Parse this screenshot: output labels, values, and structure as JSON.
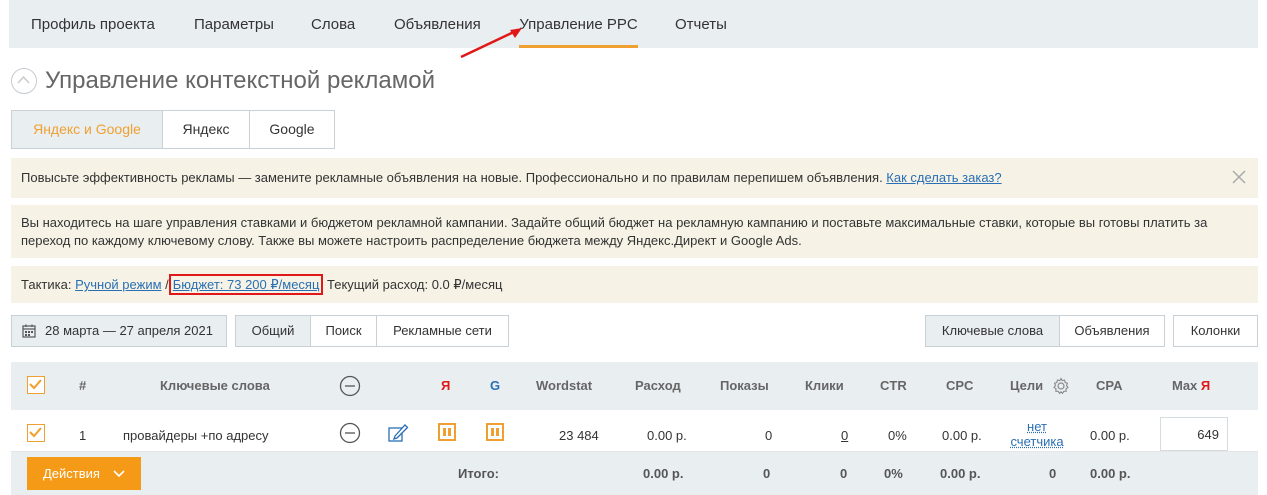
{
  "nav": {
    "tabs": [
      {
        "label": "Профиль проекта"
      },
      {
        "label": "Параметры"
      },
      {
        "label": "Слова"
      },
      {
        "label": "Объявления"
      },
      {
        "label": "Управление PPC"
      },
      {
        "label": "Отчеты"
      }
    ],
    "active_tab": "Управление PPC"
  },
  "page": {
    "title": "Управление контекстной рекламой"
  },
  "platform_switch": [
    "Яндекс и Google",
    "Яндекс",
    "Google"
  ],
  "notice": {
    "text": "Повысьте эффективность рекламы — замените рекламные объявления на новые. Профессионально и по правилам перепишем объявления. ",
    "link": "Как сделать заказ?"
  },
  "info": {
    "text": "Вы находитесь на шаге управления ставками и бюджетом рекламной кампании. Задайте общий бюджет на рекламную кампанию и поставьте максимальные ставки, которые вы готовы платить за переход по каждому ключевому слову. Также вы можете настроить распределение бюджета между Яндекс.Директ и Google Ads."
  },
  "tactic": {
    "label": "Тактика: ",
    "mode": "Ручной режим",
    "sep": " /",
    "budget": "Бюджет: 73 200 ₽/месяц",
    "spend": " Текущий расход: 0.0 ₽/месяц"
  },
  "toolbar": {
    "date_range": "28 марта — 27 апреля 2021",
    "filters": [
      "Общий",
      "Поиск",
      "Рекламные сети"
    ],
    "views": [
      "Ключевые слова",
      "Объявления"
    ],
    "columns": "Колонки"
  },
  "table": {
    "headers": {
      "num": "#",
      "keywords": "Ключевые слова",
      "yandex": "Я",
      "google": "G",
      "wordstat": "Wordstat",
      "spend": "Расход",
      "impressions": "Показы",
      "clicks": "Клики",
      "ctr": "CTR",
      "cpc": "CPC",
      "goals": "Цели",
      "cpa": "CPA",
      "max": "Max",
      "max_y": "Я"
    },
    "rows": [
      {
        "num": "1",
        "keyword": "провайдеры +по адресу",
        "wordstat": "23 484",
        "spend": "0.00 р.",
        "impressions": "0",
        "clicks": "0",
        "ctr": "0%",
        "cpc": "0.00 р.",
        "goals": "нет счетчика",
        "cpa": "0.00 р.",
        "max": "649"
      }
    ],
    "totals": {
      "label": "Итого:",
      "spend": "0.00 р.",
      "impressions": "0",
      "clicks": "0",
      "ctr": "0%",
      "cpc": "0.00 р.",
      "goals": "0",
      "cpa": "0.00 р."
    },
    "actions_label": "Действия"
  },
  "colors": {
    "accent": "#f0a030",
    "link": "#2a6fb4",
    "highlight": "#e01818",
    "yandex": "#e01818",
    "google": "#2a6fb4"
  }
}
